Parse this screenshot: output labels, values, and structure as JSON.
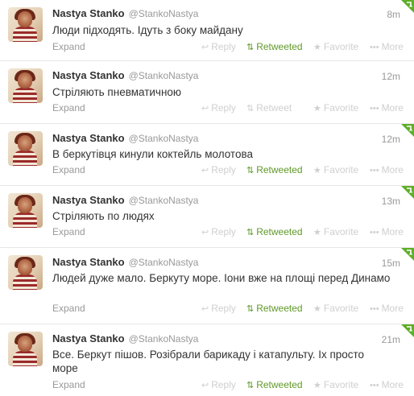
{
  "actions": {
    "expand": "Expand",
    "reply": "Reply",
    "retweet": "Retweet",
    "retweeted": "Retweeted",
    "favorite": "Favorite",
    "more": "More"
  },
  "colors": {
    "retweeted": "#609928",
    "corner_badge": "#5eae2a"
  },
  "icons": {
    "reply": "reply-arrow-icon",
    "retweet": "retweet-arrows-icon",
    "favorite": "star-icon",
    "more": "dots-icon",
    "corner": "retweeted-corner-icon"
  },
  "tweets": [
    {
      "name": "Nastya Stanko",
      "handle": "@StankoNastya",
      "time": "8m",
      "text": "Люди підходять. Ідуть з боку майдану",
      "retweeted": true
    },
    {
      "name": "Nastya Stanko",
      "handle": "@StankoNastya",
      "time": "12m",
      "text": "Стріляють пневматичною",
      "retweeted": false
    },
    {
      "name": "Nastya Stanko",
      "handle": "@StankoNastya",
      "time": "12m",
      "text": "В беркутівця кинули коктейль молотова",
      "retweeted": true
    },
    {
      "name": "Nastya Stanko",
      "handle": "@StankoNastya",
      "time": "13m",
      "text": "Стріляють по людях",
      "retweeted": true
    },
    {
      "name": "Nastya Stanko",
      "handle": "@StankoNastya",
      "time": "15m",
      "text": "Людей дуже мало. Беркуту море. Іони вже на площі перед Динамо",
      "retweeted": true
    },
    {
      "name": "Nastya Stanko",
      "handle": "@StankoNastya",
      "time": "21m",
      "text": "Все. Беркут пішов. Розібрали барикаду і катапульту. Іх просто море",
      "retweeted": true
    }
  ]
}
